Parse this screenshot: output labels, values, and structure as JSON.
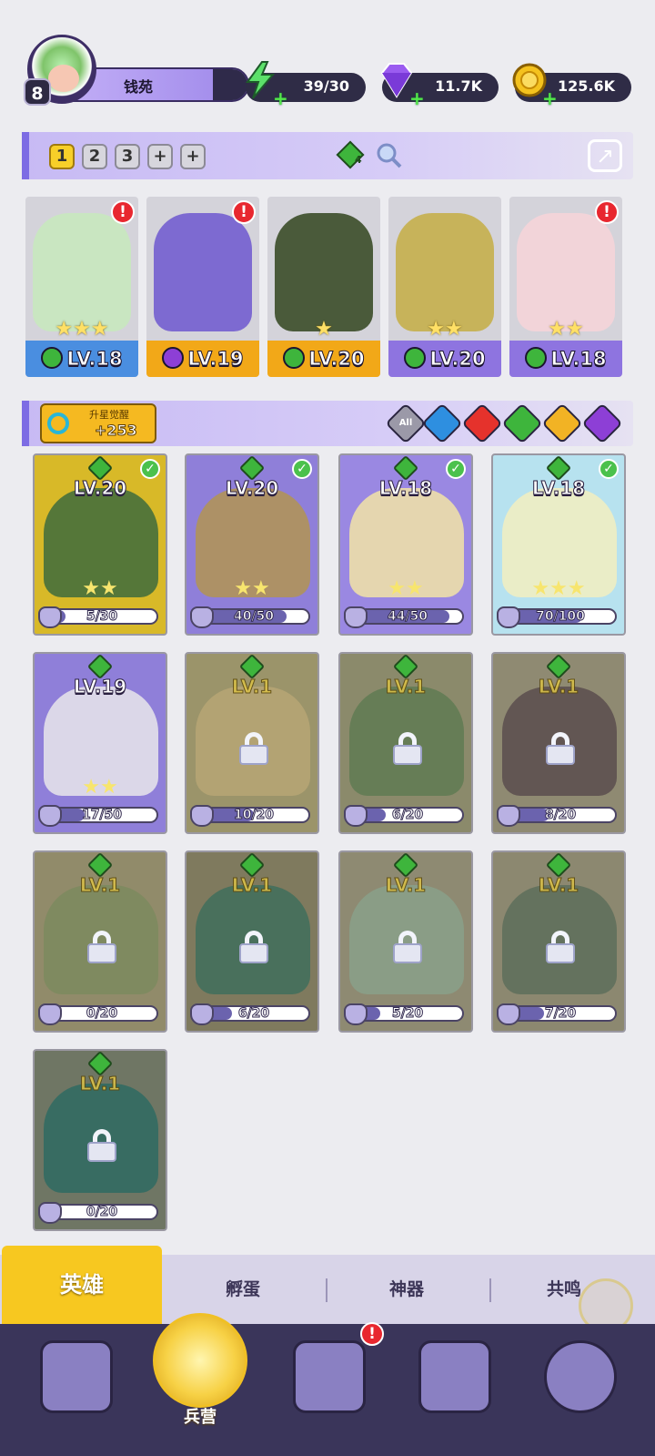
{
  "player": {
    "level": "8",
    "name": "钱苑"
  },
  "resources": [
    {
      "name": "energy",
      "icon": "lightning-icon",
      "value": "39/30"
    },
    {
      "name": "gems",
      "icon": "diamond-icon",
      "value": "11.7K"
    },
    {
      "name": "coins",
      "icon": "coin-icon",
      "value": "125.6K"
    }
  ],
  "team": {
    "slots": [
      "1",
      "2",
      "3",
      "+",
      "+"
    ],
    "active_slot": "1",
    "badge_count": "4",
    "cards": [
      {
        "level": "LV.18",
        "stars": "★★★",
        "element": "wind",
        "alert": "!",
        "foot": "#4a8ee0"
      },
      {
        "level": "LV.19",
        "stars": "",
        "element": "dark",
        "alert": "!",
        "foot": "#f2a818"
      },
      {
        "level": "LV.20",
        "stars": "★",
        "element": "wind",
        "alert": "",
        "foot": "#f2a818"
      },
      {
        "level": "LV.20",
        "stars": "★★",
        "element": "wind",
        "alert": "",
        "foot": "#8e74e0"
      },
      {
        "level": "LV.18",
        "stars": "★★",
        "element": "wind",
        "alert": "!",
        "foot": "#8e74e0"
      }
    ]
  },
  "filter": {
    "awaken_label": "升星觉醒",
    "awaken_value": "+253",
    "elements": [
      {
        "label": "All",
        "color": "#9b99a8"
      },
      {
        "label": "",
        "color": "#2e8fe0"
      },
      {
        "label": "",
        "color": "#e5322c"
      },
      {
        "label": "",
        "color": "#3eb53c"
      },
      {
        "label": "",
        "color": "#f2b324"
      },
      {
        "label": "",
        "color": "#8d3fd6"
      }
    ]
  },
  "heroes": [
    {
      "level": "LV.20",
      "progress": "5/30",
      "fill": 0.17,
      "stars": "★★",
      "locked": false,
      "check": true,
      "bg": "#d8b928",
      "glow": "#3e6b3c"
    },
    {
      "level": "LV.20",
      "progress": "40/50",
      "fill": 0.8,
      "stars": "★★",
      "locked": false,
      "check": true,
      "bg": "#8f7fd9",
      "glow": "#b39451"
    },
    {
      "level": "LV.18",
      "progress": "44/50",
      "fill": 0.88,
      "stars": "★★",
      "locked": false,
      "check": true,
      "bg": "#9a88e2",
      "glow": "#f2e4a6"
    },
    {
      "level": "LV.18",
      "progress": "70/100",
      "fill": 0.7,
      "stars": "★★★",
      "locked": false,
      "check": true,
      "bg": "#b7e2ef",
      "glow": "#f3efc0"
    },
    {
      "level": "LV.19",
      "progress": "17/50",
      "fill": 0.34,
      "stars": "★★",
      "locked": false,
      "check": false,
      "bg": "#8f7fd9",
      "glow": "#e9e6ea"
    },
    {
      "level": "LV.1",
      "progress": "10/20",
      "fill": 0.5,
      "stars": "",
      "locked": true,
      "check": false,
      "bg": "#9b946a",
      "glow": "#b7a674"
    },
    {
      "level": "LV.1",
      "progress": "6/20",
      "fill": 0.3,
      "stars": "",
      "locked": true,
      "check": false,
      "bg": "#8b8a6b",
      "glow": "#5f7a52"
    },
    {
      "level": "LV.1",
      "progress": "8/20",
      "fill": 0.4,
      "stars": "",
      "locked": true,
      "check": false,
      "bg": "#8f8a72",
      "glow": "#5a4c4e"
    },
    {
      "level": "LV.1",
      "progress": "0/20",
      "fill": 0,
      "stars": "",
      "locked": true,
      "check": false,
      "bg": "#918b6a",
      "glow": "#7b8a5e"
    },
    {
      "level": "LV.1",
      "progress": "6/20",
      "fill": 0.3,
      "stars": "",
      "locked": true,
      "check": false,
      "bg": "#7f7a5e",
      "glow": "#3f6e5c"
    },
    {
      "level": "LV.1",
      "progress": "5/20",
      "fill": 0.25,
      "stars": "",
      "locked": true,
      "check": false,
      "bg": "#8e8a72",
      "glow": "#8aa08a"
    },
    {
      "level": "LV.1",
      "progress": "7/20",
      "fill": 0.35,
      "stars": "",
      "locked": true,
      "check": false,
      "bg": "#8c8870",
      "glow": "#5d6f5a"
    },
    {
      "level": "LV.1",
      "progress": "0/20",
      "fill": 0,
      "stars": "",
      "locked": true,
      "check": false,
      "bg": "#6f7664",
      "glow": "#2f6b62"
    }
  ],
  "subtabs": [
    "英雄",
    "孵蛋",
    "神器",
    "共鸣"
  ],
  "nav": {
    "active_label": "兵营",
    "alert": "!"
  }
}
